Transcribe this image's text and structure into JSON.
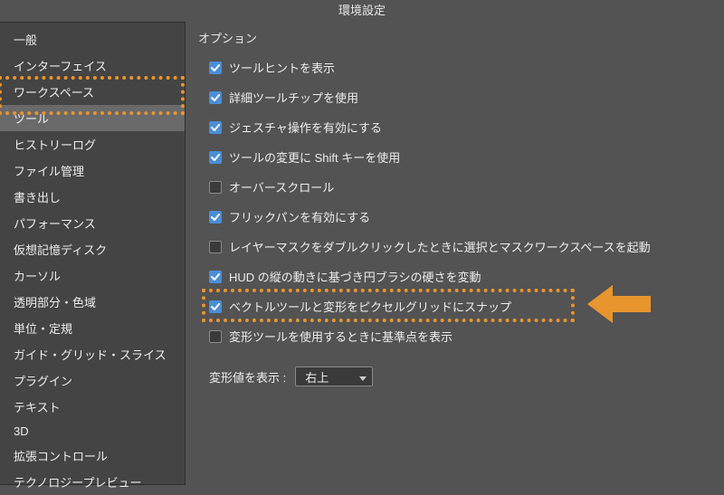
{
  "title": "環境設定",
  "sidebar": {
    "items": [
      {
        "label": "一般"
      },
      {
        "label": "インターフェイス"
      },
      {
        "label": "ワークスペース"
      },
      {
        "label": "ツール",
        "selected": true
      },
      {
        "label": "ヒストリーログ"
      },
      {
        "label": "ファイル管理"
      },
      {
        "label": "書き出し"
      },
      {
        "label": "パフォーマンス"
      },
      {
        "label": "仮想記憶ディスク"
      },
      {
        "label": "カーソル"
      },
      {
        "label": "透明部分・色域"
      },
      {
        "label": "単位・定規"
      },
      {
        "label": "ガイド・グリッド・スライス"
      },
      {
        "label": "プラグイン"
      },
      {
        "label": "テキスト"
      },
      {
        "label": "3D"
      },
      {
        "label": "拡張コントロール"
      },
      {
        "label": "テクノロジープレビュー"
      }
    ]
  },
  "section_title": "オプション",
  "options": [
    {
      "label": "ツールヒントを表示",
      "checked": true
    },
    {
      "label": "詳細ツールチップを使用",
      "checked": true
    },
    {
      "label": "ジェスチャ操作を有効にする",
      "checked": true
    },
    {
      "label": "ツールの変更に Shift キーを使用",
      "checked": true
    },
    {
      "label": "オーバースクロール",
      "checked": false
    },
    {
      "label": "フリックパンを有効にする",
      "checked": true
    },
    {
      "label": "レイヤーマスクをダブルクリックしたときに選択とマスクワークスペースを起動",
      "checked": false
    },
    {
      "label": "HUD の縦の動きに基づき円ブラシの硬さを変動",
      "checked": true
    },
    {
      "label": "ベクトルツールと変形をピクセルグリッドにスナップ",
      "checked": true
    },
    {
      "label": "変形ツールを使用するときに基準点を表示",
      "checked": false
    }
  ],
  "dropdown": {
    "label": "変形値を表示 :",
    "value": "右上"
  },
  "colors": {
    "highlight": "#e9952e"
  }
}
